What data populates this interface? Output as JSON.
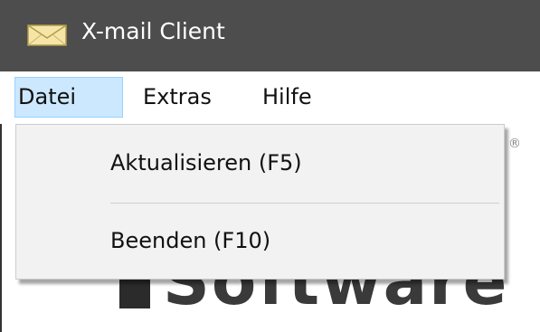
{
  "window": {
    "title": "X-mail Client",
    "icon": "envelope-icon",
    "titlebar_color": "#4d4d4d"
  },
  "menubar": {
    "items": [
      {
        "label": "Datei",
        "active": true
      },
      {
        "label": "Extras",
        "active": false
      },
      {
        "label": "Hilfe",
        "active": false
      }
    ],
    "active_color": "#cce8ff"
  },
  "dropdown": {
    "items": [
      {
        "label": "Aktualisieren (F5)"
      },
      {
        "label": "Beenden (F10)"
      }
    ]
  },
  "watermark": {
    "registered_mark": "®",
    "brand_text": "Software"
  }
}
